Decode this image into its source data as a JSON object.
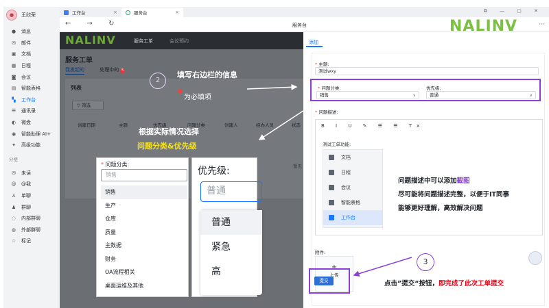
{
  "sidebar": {
    "user_name": "王欣荣",
    "items": [
      {
        "label": "消息",
        "icon": "chat-bubble-icon"
      },
      {
        "label": "邮件",
        "icon": "mail-icon"
      },
      {
        "label": "文档",
        "icon": "doc-icon"
      },
      {
        "label": "日程",
        "icon": "calendar-icon"
      },
      {
        "label": "会议",
        "icon": "meeting-icon"
      },
      {
        "label": "智能表格",
        "icon": "table-icon"
      },
      {
        "label": "工作台",
        "icon": "grid-icon"
      },
      {
        "label": "通讯录",
        "icon": "contacts-icon"
      },
      {
        "label": "微盘",
        "icon": "drive-icon"
      },
      {
        "label": "智能助理 AI+",
        "icon": "ai-icon"
      },
      {
        "label": "高级功能",
        "icon": "star-icon"
      }
    ],
    "group_label": "分组",
    "group_items": [
      {
        "label": "未读",
        "icon": "unread-icon"
      },
      {
        "label": "@我",
        "icon": "at-icon"
      },
      {
        "label": "单聊",
        "icon": "single-chat-icon"
      },
      {
        "label": "群聊",
        "icon": "group-chat-icon"
      },
      {
        "label": "内部群聊",
        "icon": "internal-chat-icon"
      },
      {
        "label": "外部群聊",
        "icon": "external-chat-icon"
      },
      {
        "label": "标记",
        "icon": "tag-icon"
      }
    ],
    "active_index": 6
  },
  "browser": {
    "tabs": [
      {
        "label": "工作台"
      },
      {
        "label": "服务台"
      }
    ],
    "close_glyph": "×",
    "window_controls": "⧉ — ▢ ✕",
    "nav_glyphs": "← → ↻",
    "page_title": "服务台",
    "brand": "NALINV",
    "more_glyph": "···"
  },
  "app": {
    "logo": "NALINV",
    "nav_item_1": "服务工单",
    "nav_item_2": "会议预约",
    "title": "服务工单",
    "tab_active": "我发起的",
    "tab_other": "处理中的",
    "badge_count": "5",
    "panel_title": "列表",
    "filter_label": "筛选",
    "columns": [
      "创建日期",
      "主题",
      "优先级",
      "问题分类",
      "创建人",
      "经办人员",
      "状态"
    ],
    "empty_label": "暂无"
  },
  "annotations": {
    "step2": "2",
    "step2_text": "填写右边栏的信息",
    "required_star": "*",
    "required_text": "为必填项",
    "choose_text": "根据实际情况选择",
    "choose_highlight": "问题分类&优先级",
    "step3": "3",
    "desc_line1_a": "问题描述中可以添加",
    "desc_line1_b": "截图",
    "desc_line2": "尽可能将问题描述完整，以便于IT同事",
    "desc_line3": "能够更好理解，高效解决问题",
    "final_a": "点击”提交“按钮，",
    "final_b": "即完成了此次工单提交"
  },
  "zoom_category": {
    "label": "问题分类:",
    "placeholder": "销售",
    "options": [
      "销售",
      "生产",
      "仓库",
      "质量",
      "主数据",
      "财务",
      "OA流程相关",
      "桌面运维及其他"
    ],
    "selected_index": 0
  },
  "zoom_priority": {
    "label": "优先级:",
    "placeholder": "普通",
    "options": [
      "普通",
      "紧急",
      "高"
    ],
    "selected_index": 0
  },
  "form": {
    "tab": "添加",
    "subject_label": "主题:",
    "subject_value": "测试wxy",
    "category_label": "问题分类:",
    "category_value": "销售",
    "priority_label": "优先级:",
    "priority_value": "普通",
    "desc_label": "问题描述:",
    "toolbar": "B I U ✎ ☰ ☰ Tx",
    "editor_text": "测试工单功能:",
    "shot_items": [
      "文档",
      "日程",
      "会议",
      "智能表格",
      "工作台"
    ],
    "shot_active_index": 4,
    "attach_label": "附件:",
    "upload_plus": "+",
    "upload_label": "上传",
    "submit_label": "提交"
  },
  "colors": {
    "accent": "#1677ff",
    "brand_green": "#7bc142",
    "highlight_purple": "#8b3fd6",
    "required_red": "#f54a45"
  }
}
